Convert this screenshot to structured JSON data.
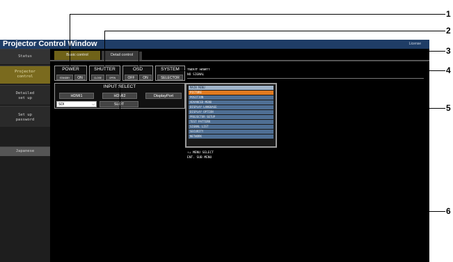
{
  "window": {
    "title": "Projector Control Window",
    "license_label": "License"
  },
  "sidebar": {
    "items": [
      {
        "label": "Status"
      },
      {
        "label": "Projector\ncontrol"
      },
      {
        "label": "Detailed\nset up"
      },
      {
        "label": "Set up\npassword"
      },
      {
        "label": "Japanese"
      }
    ]
  },
  "tabs": {
    "basic": "Basic control",
    "detail": "Detail control"
  },
  "groups": {
    "power": {
      "label": "POWER",
      "buttons": [
        "STANDBY",
        "ON"
      ]
    },
    "shutter": {
      "label": "SHUTTER",
      "buttons": [
        "CLOSE",
        "OPEN"
      ]
    },
    "osd": {
      "label": "OSD",
      "buttons": [
        "OFF",
        "ON"
      ]
    },
    "system": {
      "label": "SYSTEM",
      "buttons": [
        "SELECTOR"
      ]
    }
  },
  "input_select": {
    "label": "INPUT SELECT",
    "buttons": [
      "HDMI1",
      "HDMI2",
      "DisplayPort"
    ],
    "dropdown_value": "SDI",
    "slot": "SLOT"
  },
  "osd_display": {
    "input_line": "INPUT HDMI1",
    "signal_line": "NO SIGNAL",
    "menu_items": [
      "MAIN MENU",
      "PICTURE",
      "POSITION",
      "ADVANCED MENU",
      "DISPLAY LANGUAGE",
      "DISPLAY OPTION",
      "PROJECTOR SETUP",
      "TEST PATTERN",
      "SIGNAL LIST",
      "SECURITY",
      "NETWORK"
    ],
    "help_line1": "↑↓    MENU SELECT",
    "help_line2": "ENT.  SUB MENU"
  },
  "callouts": [
    "1",
    "2",
    "3",
    "4",
    "5",
    "6"
  ]
}
